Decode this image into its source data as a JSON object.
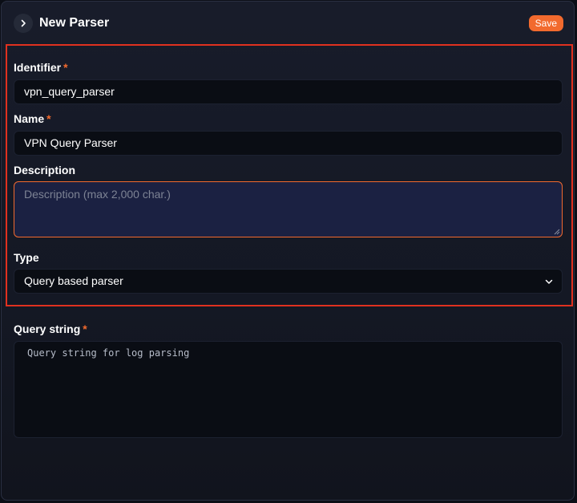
{
  "header": {
    "expand_icon": "chevron-right-icon",
    "title": "New Parser",
    "save_label": "Save"
  },
  "form": {
    "identifier": {
      "label": "Identifier",
      "required_mark": "*",
      "value": "vpn_query_parser"
    },
    "name": {
      "label": "Name",
      "required_mark": "*",
      "value": "VPN Query Parser"
    },
    "description": {
      "label": "Description",
      "value": "",
      "placeholder": "Description (max 2,000 char.)"
    },
    "type": {
      "label": "Type",
      "selected": "Query based parser",
      "dropdown_icon": "chevron-down-icon"
    },
    "query_string": {
      "label": "Query string",
      "required_mark": "*",
      "value": "",
      "placeholder": "Query string for log parsing"
    }
  },
  "colors": {
    "accent": "#f26a2e",
    "highlight_border": "#e0311f",
    "background": "#141824"
  }
}
